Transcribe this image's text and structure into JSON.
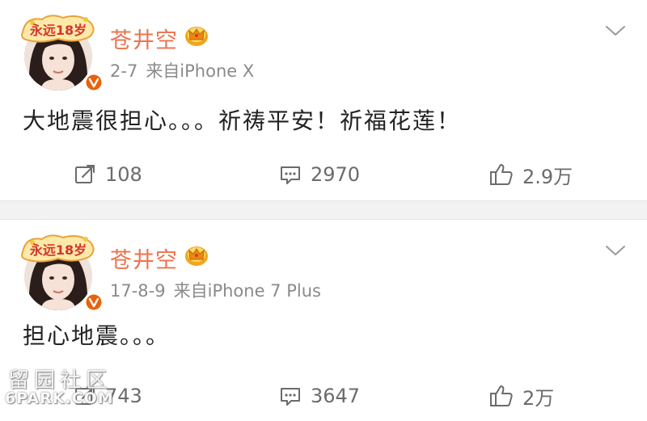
{
  "colors": {
    "username": "#eb7350",
    "meta": "#8a8a8a",
    "text": "#222222",
    "action": "#6b6b6b",
    "separator": "#f2f2f2",
    "verified_badge": "#e8620c",
    "crown": "#f2a51f"
  },
  "posts": [
    {
      "username": "苍井空",
      "frame_text": "永远18岁",
      "time": "2-7",
      "source": "来自iPhone X",
      "text": "大地震很担心。。。祈祷平安！祈福花莲！",
      "repost_count": "108",
      "comment_count": "2970",
      "like_count": "2.9万",
      "icons": [
        "avatar",
        "crown-icon",
        "verified-icon",
        "chevron-down-icon",
        "repost-icon",
        "comment-icon",
        "like-icon"
      ]
    },
    {
      "username": "苍井空",
      "frame_text": "永远18岁",
      "time": "17-8-9",
      "source": "来自iPhone 7 Plus",
      "text": "担心地震。。。",
      "repost_count": "743",
      "comment_count": "3647",
      "like_count": "2万",
      "icons": [
        "avatar",
        "crown-icon",
        "verified-icon",
        "chevron-down-icon",
        "repost-icon",
        "comment-icon",
        "like-icon"
      ]
    }
  ],
  "watermark": {
    "cn": "留园社区",
    "en": "6PARK.COM"
  }
}
